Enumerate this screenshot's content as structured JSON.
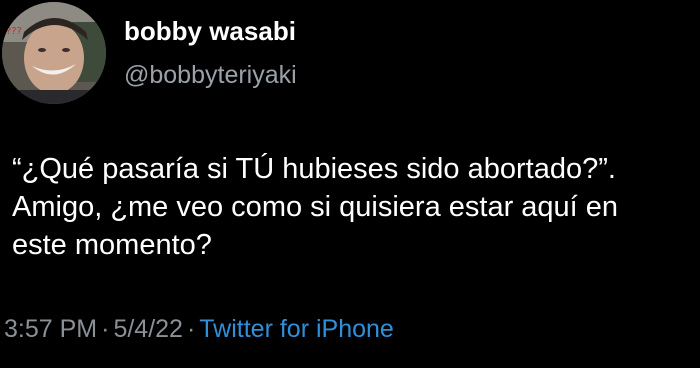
{
  "author": {
    "display_name": "bobby wasabi",
    "handle": "@bobbyteriyaki",
    "avatar_icon": "profile-photo"
  },
  "tweet": {
    "lines": [
      "“¿Qué pasaría si TÚ hubieses sido abortado?”.",
      "Amigo, ¿me veo como si quisiera estar aquí en",
      "este momento?"
    ]
  },
  "meta": {
    "time": "3:57 PM",
    "date": "5/4/22",
    "separator": "·",
    "source": "Twitter for iPhone"
  },
  "colors": {
    "background": "#000000",
    "text": "#ffffff",
    "muted": "#8b9096",
    "link": "#2f8fd8"
  }
}
